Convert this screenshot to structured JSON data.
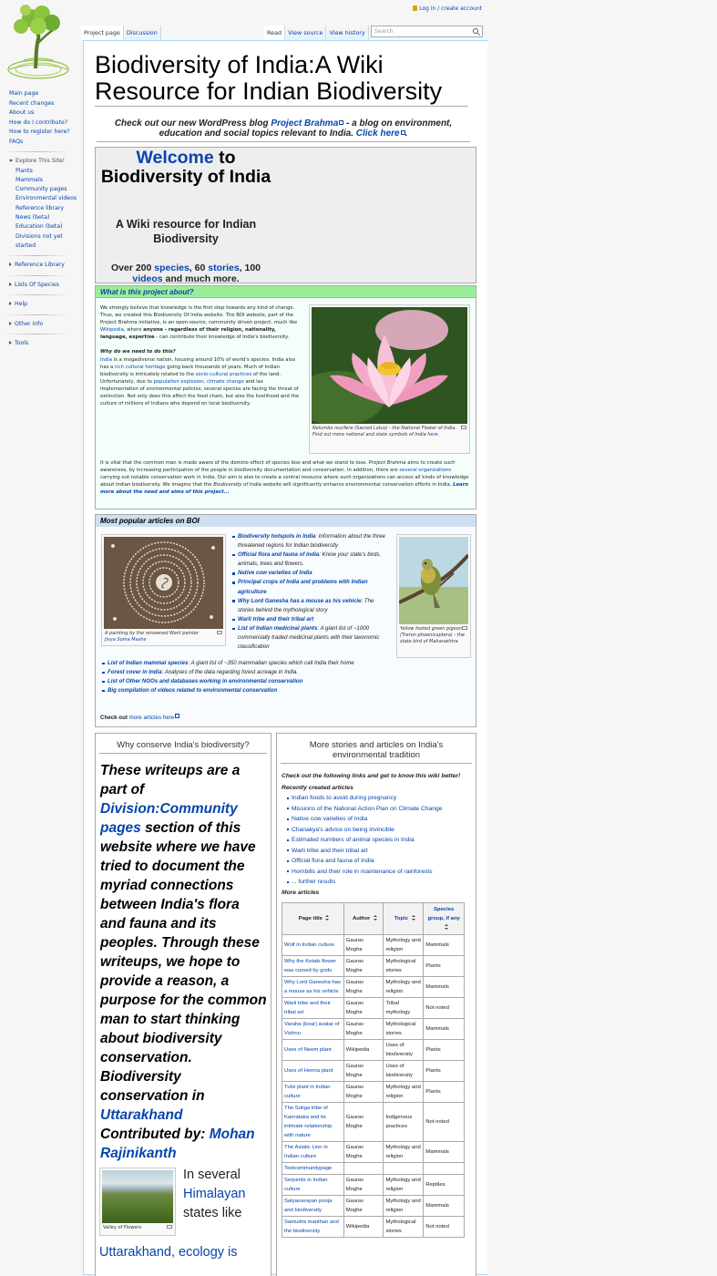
{
  "personal": {
    "login": "Log in / create account"
  },
  "tabs": {
    "project_page": "Project page",
    "discussion": "Discussion",
    "read": "Read",
    "view_source": "View source",
    "view_history": "View history"
  },
  "search": {
    "placeholder": "Search"
  },
  "sidebar": {
    "nav": [
      "Main page",
      "Recent changes",
      "About us",
      "How do I contribute?",
      "How to register here?",
      "FAQs"
    ],
    "explore_heading": "Explore This Site!",
    "explore": [
      "Plants",
      "Mammals",
      "Community pages",
      "Environmental videos",
      "Reference library",
      "News (beta)",
      "Education (beta)",
      "Divisions not yet",
      "started"
    ],
    "portals": [
      "Reference Library",
      "Lists Of Species",
      "Help",
      "Other info",
      "Tools"
    ]
  },
  "page": {
    "title": "Biodiversity of India:A Wiki Resource for Indian Biodiversity"
  },
  "blog": {
    "pre": "Check out our new WordPress blog ",
    "link": "Project Brahma",
    "mid": " - a blog on environment, education and social topics relevant to India. ",
    "click": "Click here",
    "end": "."
  },
  "welcome": {
    "welcome": "Welcome",
    "to": " to Biodiversity of India",
    "subtitle": "A Wiki resource for Indian Biodiversity",
    "s1": "Over 200 ",
    "species": "species",
    "s2": ", 60 ",
    "stories": "stories",
    "s3": ", 100 ",
    "videos": "videos",
    "s4": " and much more."
  },
  "about": {
    "heading": "What is this project about?",
    "p1a": "We strongly believe that knowledge is the first step towards any kind of change. Thus, we created this Biodiversity Of India website. The BOI website, part of the Project Brahma initiative, is an open-source, community driven project, much like ",
    "p1link": "Wikipedia",
    "p1b": ", where ",
    "p1bold": "anyone - regardless of their religion, nationality, language, expertise",
    "p1c": " - can contribute their knowledge of India's biodiversity.",
    "why": "Why do we need to do this?",
    "p2": [
      {
        "t": "India",
        "l": true
      },
      {
        "t": " is a megadiverse nation, housing around 10% of world's species. India also has a "
      },
      {
        "t": "rich cultural heritage",
        "l": true
      },
      {
        "t": " going back thousands of years. Much of Indian biodiversity is intricately related to the "
      },
      {
        "t": "socio-cultural practices",
        "l": true
      },
      {
        "t": " of the land. Unfortunately, due to "
      },
      {
        "t": "population explosion",
        "l": true
      },
      {
        "t": ", "
      },
      {
        "t": "climate change",
        "l": true
      },
      {
        "t": " and lax implementation of environmental policies, several species are facing the threat of extinction. Not only does this affect the food chain, but also the livelihood and the culture of millions of Indians who depend on local biodiversity."
      }
    ],
    "p3": [
      {
        "t": "It is vital that the common man is made aware of the domino effect of species loss and what we stand to lose. "
      },
      {
        "t": "Project Brahma",
        "i": true
      },
      {
        "t": " aims to create such awareness, by increasing participation of the people in biodiversity documentation and conservation. In addition, there are "
      },
      {
        "t": "several organizations",
        "l": true
      },
      {
        "t": " carrying out notable conservation work in India. Our aim is also to create a central resource where such organizations can access all kinds of knowledge about Indian biodiversity. We imagine that the "
      },
      {
        "t": "Biodiversity of India",
        "i": true
      },
      {
        "t": " website will significantly enhance environmental conservation efforts in India. "
      },
      {
        "t": "Learn more about the need and aims of this project...",
        "l": true,
        "b": true
      }
    ],
    "lotus_caption": [
      {
        "t": "Nelumbo nucifera",
        "i": true
      },
      {
        "t": " (Sacred Lotus) - the National Flower of India. Find out more national and state symbols of India "
      },
      {
        "t": "here",
        "l": true
      },
      {
        "t": "."
      }
    ]
  },
  "popular": {
    "heading": "Most popular articles on BOI",
    "warli_caption_pre": "A painting by the renowned Warli painter ",
    "warli_caption_link": "Jivya Soma Mashe",
    "pigeon_caption": "Yellow footed green pigeon (Treron phoenicoptera) - the state bird of Maharashtra",
    "list1": [
      {
        "t": "Biodiversity hotspots in India",
        "d": ": Information about the three threatened regions for Indian biodiversity"
      },
      {
        "t": "Official flora and fauna of India",
        "d": ": Know your state's birds, animals, trees and flowers."
      },
      {
        "t": "Native cow varieties of India",
        "d": ""
      },
      {
        "t": "Principal crops of India and problems with Indian agriculture",
        "d": ""
      },
      {
        "t": "Why Lord Ganesha has a mouse as his vehicle",
        "d": ": The stories behind the mythological story"
      },
      {
        "t": "Warli tribe and their tribal art",
        "d": ""
      },
      {
        "t": "List of Indian medicinal plants",
        "d": ": A giant list of ~1000 commercially traded medicinal plants with their taxonomic classification"
      }
    ],
    "list2": [
      {
        "t": "List of Indian mammal species",
        "d": ": A giant list of ~350 mammalian species which call India their home"
      },
      {
        "t": "Forest cover in India",
        "d": ": Analyses of the data regarding forest acreage in India."
      },
      {
        "t": "List of Other NGOs and databases working in environmental conservation",
        "d": ""
      },
      {
        "t": "Big compilation of videos related to environmental conservation",
        "d": ""
      }
    ],
    "checkout": "Check out ",
    "more_link": "more articles here"
  },
  "why": {
    "heading": "Why conserve India's biodiversity?",
    "b1": "These writeups are a part of ",
    "b1link": "Division:Community pages",
    "b2": " section of this website where we have tried to document the myriad connections between India's flora and fauna and its peoples. Through these writeups, we hope to provide a reason, a purpose for the common man to start thinking about biodiversity conservation.",
    "b3": "Biodiversity conservation in ",
    "b3link": "Uttarakhand",
    "b4": "Contributed by: ",
    "b4link": "Mohan Rajinikanth",
    "valley_caption": "Valley of Flowers",
    "in1": "In several ",
    "inlink": "Himalayan",
    "in2": " states like",
    "cut": "Uttarakhand, ecology is"
  },
  "more": {
    "heading": "More stories and articles on India's environmental tradition",
    "intro": "Check out the following links and get to know this wiki better!",
    "recent_label": "Recently created articles",
    "recent": [
      "Indian foods to avoid during pregnancy",
      "Missions of the National Action Plan on Climate Change",
      "Native cow varieties of India",
      "Chanakya's advice on being invincible",
      "Estimated numbers of animal species in India",
      "Warli tribe and their tribal art",
      "Official flora and fauna of India",
      "Hornbills and their role in maintenance of rainforests",
      "... further results"
    ],
    "more_label": "More articles",
    "table": {
      "headers": [
        "Page title",
        "Author",
        "Topic",
        "Species group, if any"
      ],
      "rows": [
        [
          "Wolf in Indian culture",
          "Gaurav Moghe",
          "Mythology and religion",
          "Mammals"
        ],
        [
          "Why the Ketaki flower was cursed by gods",
          "Gaurav Moghe",
          "Mythological stories",
          "Plants"
        ],
        [
          "Why Lord Ganesha has a mouse as his vehicle",
          "Gaurav Moghe",
          "Mythology and religion",
          "Mammals"
        ],
        [
          "Warli tribe and their tribal art",
          "Gaurav Moghe",
          "Tribal mythology",
          "Not noted"
        ],
        [
          "Varaha (boar) avatar of Vishnu",
          "Gaurav Moghe",
          "Mythological stories",
          "Mammals"
        ],
        [
          "Uses of Neem plant",
          "Wikipedia",
          "Uses of biodiversity",
          "Plants"
        ],
        [
          "Uses of Henna plant",
          "Gaurav Moghe",
          "Uses of biodiversity",
          "Plants"
        ],
        [
          "Tulsi plant in Indian culture",
          "Gaurav Moghe",
          "Mythology and religion",
          "Plants"
        ],
        [
          "The Soliga tribe of Karnataka and its intimate relationship with nature",
          "Gaurav Moghe",
          "Indigenous practices",
          "Not noted"
        ],
        [
          "The Asiatic Lion in Indian culture",
          "Gaurav Moghe",
          "Mythology and religion",
          "Mammals"
        ],
        [
          "Testcommunitypage",
          "",
          "",
          ""
        ],
        [
          "Serpents in Indian culture",
          "Gaurav Moghe",
          "Mythology and religion",
          "Reptiles"
        ],
        [
          "Satyanarayan pooja and biodiversity",
          "Gaurav Moghe",
          "Mythology and religion",
          "Mammals"
        ],
        [
          "Samudra manthan and the biodiversity",
          "Wikipedia",
          "Mythological stories",
          "Not noted"
        ]
      ]
    }
  }
}
